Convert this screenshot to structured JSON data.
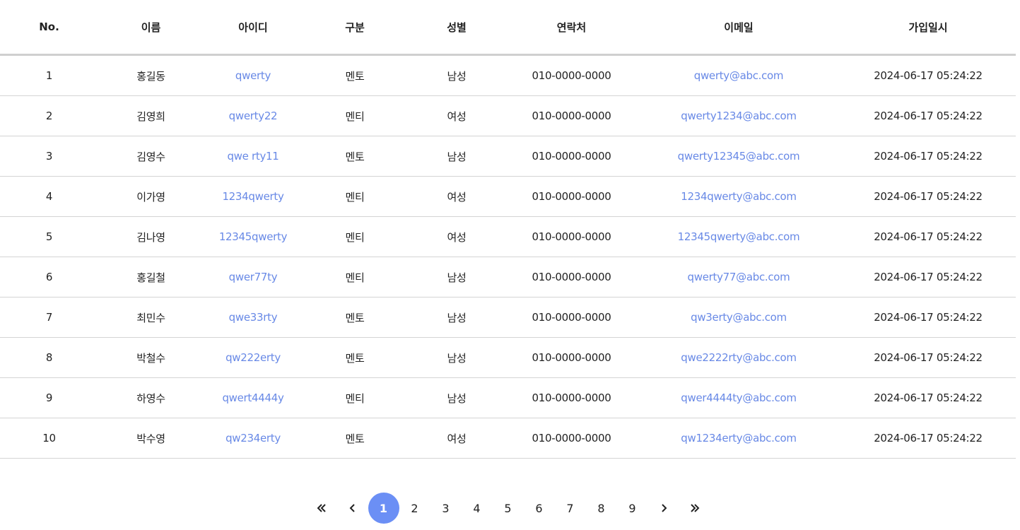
{
  "table": {
    "headers": [
      "No.",
      "이름",
      "아이디",
      "구분",
      "성별",
      "연락처",
      "이메일",
      "가입일시"
    ],
    "rows": [
      {
        "no": "1",
        "name": "홍길동",
        "id": "qwerty",
        "type": "멘토",
        "gender": "남성",
        "phone": "010-0000-0000",
        "email": "qwerty@abc.com",
        "joined": "2024-06-17 05:24:22"
      },
      {
        "no": "2",
        "name": "김영희",
        "id": "qwerty22",
        "type": "멘티",
        "gender": "여성",
        "phone": "010-0000-0000",
        "email": "qwerty1234@abc.com",
        "joined": "2024-06-17 05:24:22"
      },
      {
        "no": "3",
        "name": "김영수",
        "id": "qwe rty11",
        "type": "멘토",
        "gender": "남성",
        "phone": "010-0000-0000",
        "email": "qwerty12345@abc.com",
        "joined": "2024-06-17 05:24:22"
      },
      {
        "no": "4",
        "name": "이가영",
        "id": "1234qwerty",
        "type": "멘티",
        "gender": "여성",
        "phone": "010-0000-0000",
        "email": "1234qwerty@abc.com",
        "joined": "2024-06-17 05:24:22"
      },
      {
        "no": "5",
        "name": "김나영",
        "id": "12345qwerty",
        "type": "멘티",
        "gender": "여성",
        "phone": "010-0000-0000",
        "email": "12345qwerty@abc.com",
        "joined": "2024-06-17 05:24:22"
      },
      {
        "no": "6",
        "name": "홍길철",
        "id": "qwer77ty",
        "type": "멘티",
        "gender": "남성",
        "phone": "010-0000-0000",
        "email": "qwerty77@abc.com",
        "joined": "2024-06-17 05:24:22"
      },
      {
        "no": "7",
        "name": "최민수",
        "id": "qwe33rty",
        "type": "멘토",
        "gender": "남성",
        "phone": "010-0000-0000",
        "email": "qw3erty@abc.com",
        "joined": "2024-06-17 05:24:22"
      },
      {
        "no": "8",
        "name": "박철수",
        "id": "qw222erty",
        "type": "멘토",
        "gender": "남성",
        "phone": "010-0000-0000",
        "email": "qwe2222rty@abc.com",
        "joined": "2024-06-17 05:24:22"
      },
      {
        "no": "9",
        "name": "하영수",
        "id": "qwert4444y",
        "type": "멘티",
        "gender": "남성",
        "phone": "010-0000-0000",
        "email": "qwer4444ty@abc.com",
        "joined": "2024-06-17 05:24:22"
      },
      {
        "no": "10",
        "name": "박수영",
        "id": "qw234erty",
        "type": "멘토",
        "gender": "여성",
        "phone": "010-0000-0000",
        "email": "qw1234erty@abc.com",
        "joined": "2024-06-17 05:24:22"
      }
    ]
  },
  "pagination": {
    "first_icon": "double-chevron-left-icon",
    "prev_icon": "chevron-left-icon",
    "next_icon": "chevron-right-icon",
    "last_icon": "double-chevron-right-icon",
    "pages": [
      "1",
      "2",
      "3",
      "4",
      "5",
      "6",
      "7",
      "8",
      "9"
    ],
    "current": "1"
  },
  "colors": {
    "link": "#6889e6",
    "active_page": "#6b8ff5",
    "header_border": "#cfcfcf",
    "row_border": "#d4d4d4"
  }
}
